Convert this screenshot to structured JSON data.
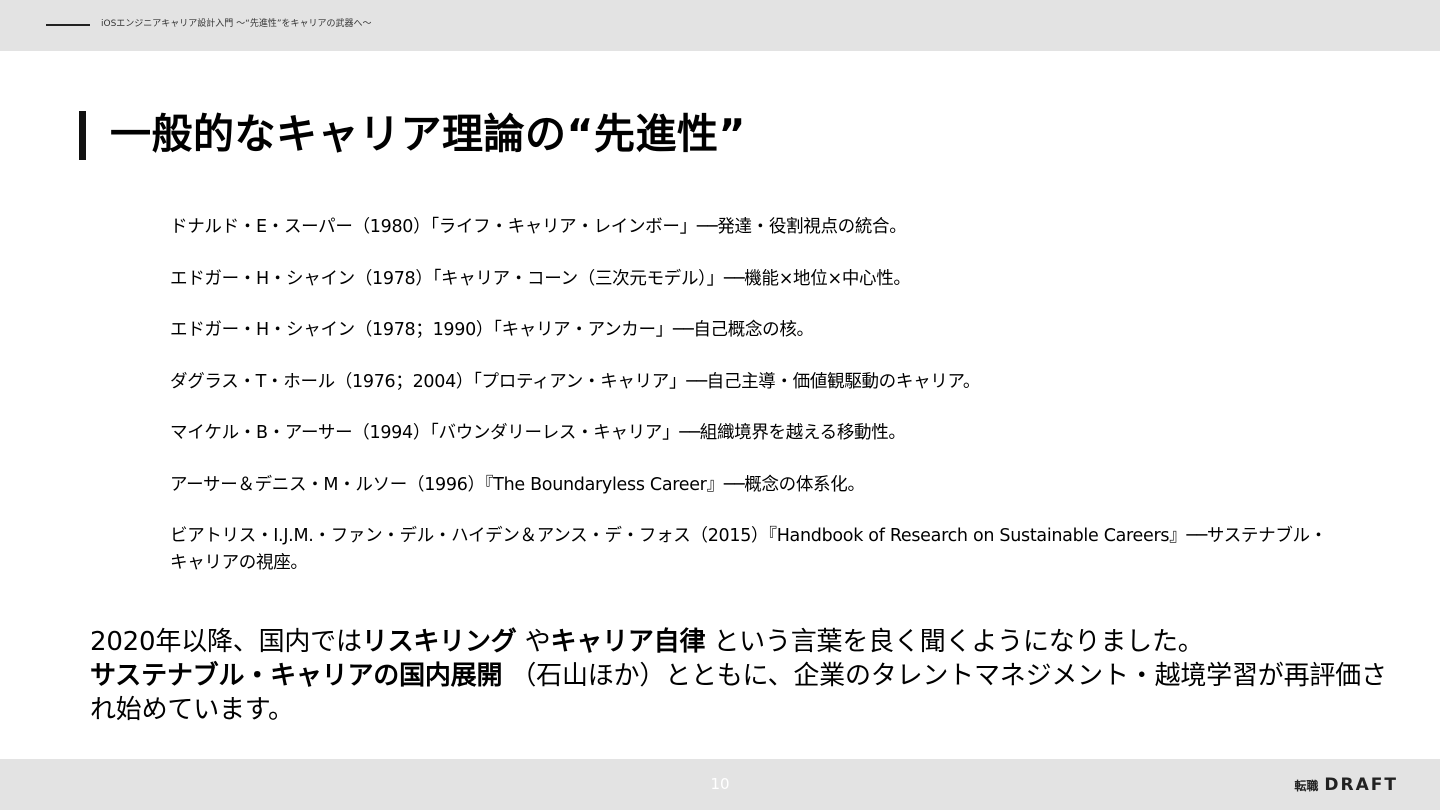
{
  "header": {
    "deck_title": "iOSエンジニアキャリア設計入門 〜“先進性”をキャリアの武器へ〜"
  },
  "slide": {
    "title": "一般的なキャリア理論の“先進性”",
    "references": [
      "ドナルド・E・スーパー（1980）「ライフ・キャリア・レインボー」──発達・役割視点の統合。",
      "エドガー・H・シャイン（1978）「キャリア・コーン（三次元モデル）」──機能×地位×中心性。",
      "エドガー・H・シャイン（1978；1990）「キャリア・アンカー」──自己概念の核。",
      "ダグラス・T・ホール（1976；2004）「プロティアン・キャリア」──自己主導・価値観駆動のキャリア。",
      "マイケル・B・アーサー（1994）「バウンダリーレス・キャリア」──組織境界を越える移動性。",
      "アーサー＆デニス・M・ルソー（1996）『The Boundaryless Career』──概念の体系化。",
      "ビアトリス・I.J.M.・ファン・デル・ハイデン＆アンス・デ・フォス（2015）『Handbook of Research on Sustainable Careers』──サステナブル・キャリアの視座。"
    ],
    "body": {
      "part1": "2020年以降、国内では",
      "bold1": "リスキリング",
      "part2": " や",
      "bold2": "キャリア自律",
      "part3": " という言葉を良く聞くようになりました。",
      "bold3": "サステナブル・キャリアの国内展開",
      "part4": " （石山ほか）とともに、企業のタレントマネジメント・越境学習が再評価され始めています。"
    }
  },
  "footer": {
    "page_number": "10",
    "logo_jp": "転職",
    "logo_en": "DRAFT"
  }
}
